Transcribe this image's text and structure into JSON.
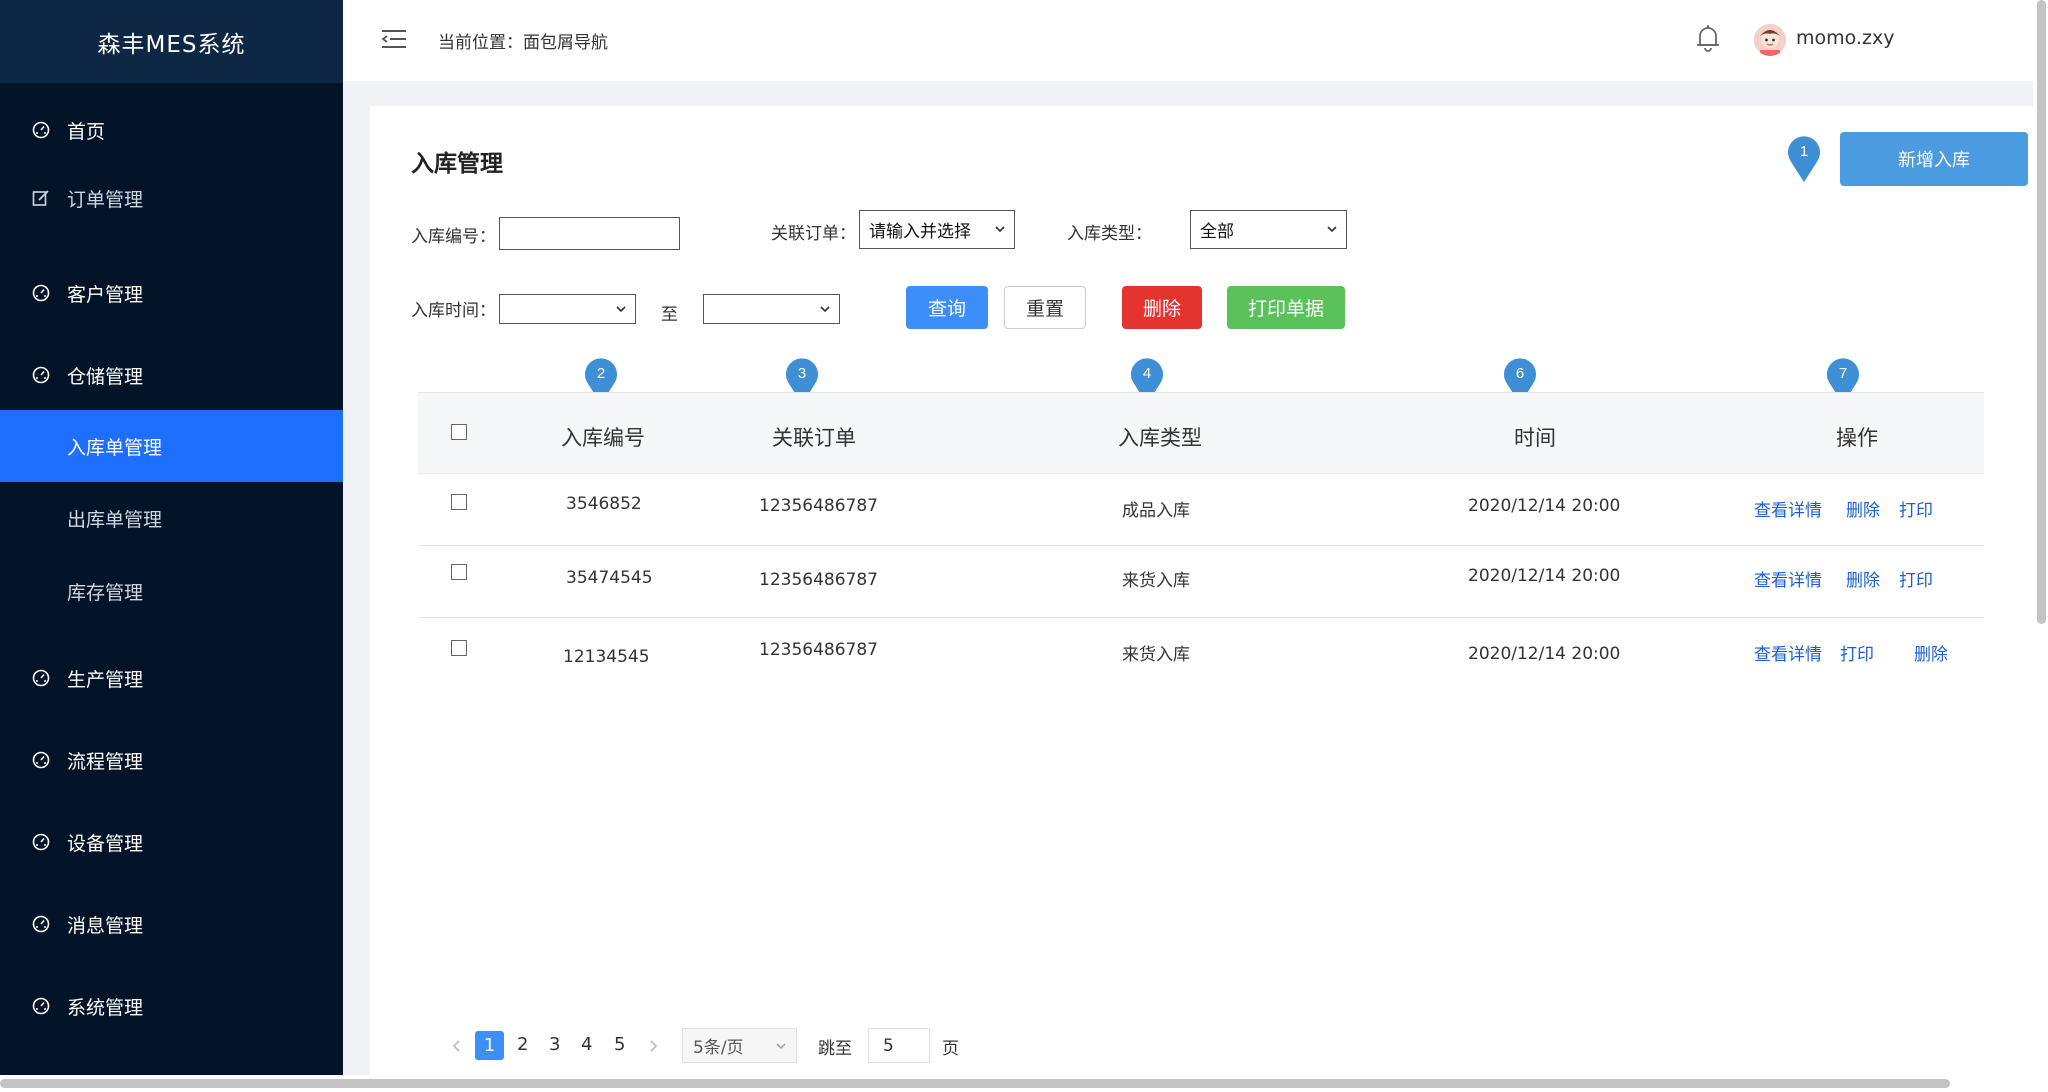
{
  "app": {
    "title": "森丰MES系统"
  },
  "sidebar": {
    "items": [
      {
        "label": "首页",
        "icon": "dashboard-icon"
      },
      {
        "label": "订单管理",
        "icon": "edit-icon"
      },
      {
        "label": "客户管理",
        "icon": "dashboard-icon"
      },
      {
        "label": "仓储管理",
        "icon": "dashboard-icon"
      },
      {
        "label": "入库单管理",
        "active": true
      },
      {
        "label": "出库单管理"
      },
      {
        "label": "库存管理"
      },
      {
        "label": "生产管理",
        "icon": "dashboard-icon"
      },
      {
        "label": "流程管理",
        "icon": "dashboard-icon"
      },
      {
        "label": "设备管理",
        "icon": "dashboard-icon"
      },
      {
        "label": "消息管理",
        "icon": "dashboard-icon"
      },
      {
        "label": "系统管理",
        "icon": "dashboard-icon"
      }
    ]
  },
  "header": {
    "breadcrumb": "当前位置：面包屑导航",
    "username": "momo.zxy"
  },
  "page": {
    "title": "入库管理",
    "new_button": "新增入库"
  },
  "filters": {
    "code_label": "入库编号：",
    "code_value": "",
    "order_label": "关联订单：",
    "order_value": "请输入并选择",
    "type_label": "入库类型：",
    "type_value": "全部",
    "time_label": "入库时间：",
    "time_to": "至",
    "time_from_value": "",
    "time_to_value": ""
  },
  "actions": {
    "query": "查询",
    "reset": "重置",
    "delete": "删除",
    "print": "打印单据"
  },
  "markers": [
    "1",
    "2",
    "3",
    "4",
    "6",
    "7"
  ],
  "table": {
    "columns": [
      "入库编号",
      "关联订单",
      "入库类型",
      "时间",
      "操作"
    ],
    "rows": [
      {
        "code": "3546852",
        "order": "12356486787",
        "type": "成品入库",
        "time": "2020/12/14 20:00",
        "ops": [
          "查看详情",
          "删除",
          "打印"
        ]
      },
      {
        "code": "35474545",
        "order": "12356486787",
        "type": "来货入库",
        "time": "2020/12/14 20:00",
        "ops": [
          "查看详情",
          "删除",
          "打印"
        ]
      },
      {
        "code": "12134545",
        "order": "12356486787",
        "type": "来货入库",
        "time": "2020/12/14 20:00",
        "ops": [
          "查看详情",
          "打印",
          "删除"
        ]
      }
    ]
  },
  "pagination": {
    "pages": [
      "1",
      "2",
      "3",
      "4",
      "5"
    ],
    "current": "1",
    "page_size": "5条/页",
    "jump_label": "跳至",
    "jump_value": "5",
    "page_suffix": "页"
  },
  "colors": {
    "sidebar_bg": "#031428",
    "active_menu": "#1e6fff",
    "primary": "#3d8ef8",
    "danger": "#e3342f",
    "success": "#5bc15b",
    "marker": "#3f8fd6"
  }
}
